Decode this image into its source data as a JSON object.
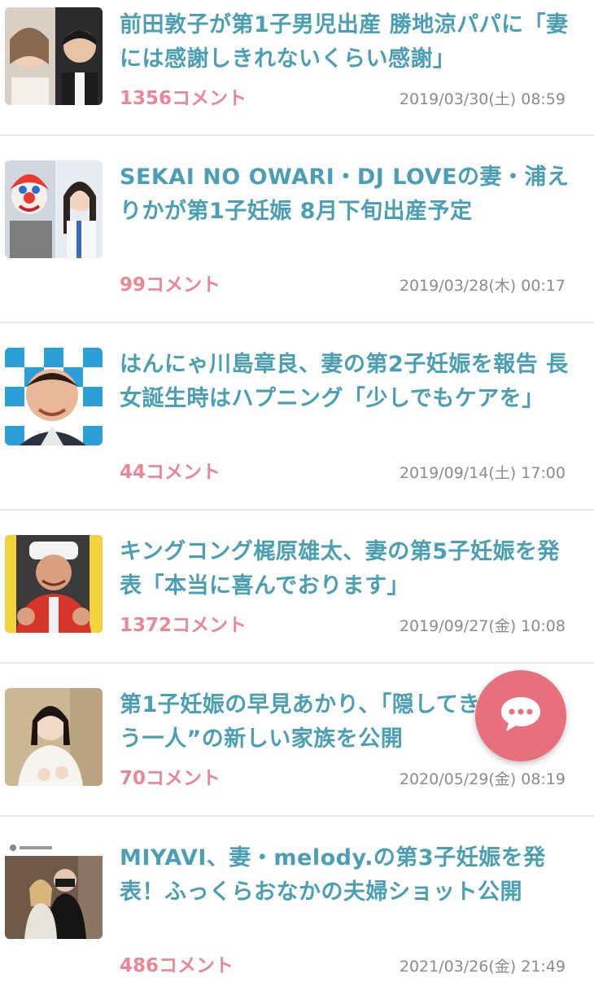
{
  "articles": [
    {
      "title": "前田敦子が第1子男児出産 勝地涼パパに「妻には感謝しきれないくらい感謝」",
      "comments": "1356コメント",
      "date": "2019/03/30(土) 08:59"
    },
    {
      "title": "SEKAI NO OWARI・DJ LOVEの妻・浦えりかが第1子妊娠 8月下旬出産予定",
      "comments": "99コメント",
      "date": "2019/03/28(木) 00:17"
    },
    {
      "title": "はんにゃ川島章良、妻の第2子妊娠を報告 長女誕生時はハプニング「少しでもケアを」",
      "comments": "44コメント",
      "date": "2019/09/14(土) 17:00"
    },
    {
      "title": "キングコング梶原雄太、妻の第5子妊娠を発表「本当に喜んでおります」",
      "comments": "1372コメント",
      "date": "2019/09/27(金) 10:08"
    },
    {
      "title": "第1子妊娠の早見あかり、「隠してきた」“もう一人”の新しい家族を公開",
      "comments": "70コメント",
      "date": "2020/05/29(金) 08:19"
    },
    {
      "title": "MIYAVI、妻・melody.の第3子妊娠を発表！ふっくらおなかの夫婦ショット公開",
      "comments": "486コメント",
      "date": "2021/03/26(金) 21:49"
    }
  ],
  "fab": {
    "icon": "chat-bubble-icon",
    "color": "#e8707c"
  }
}
